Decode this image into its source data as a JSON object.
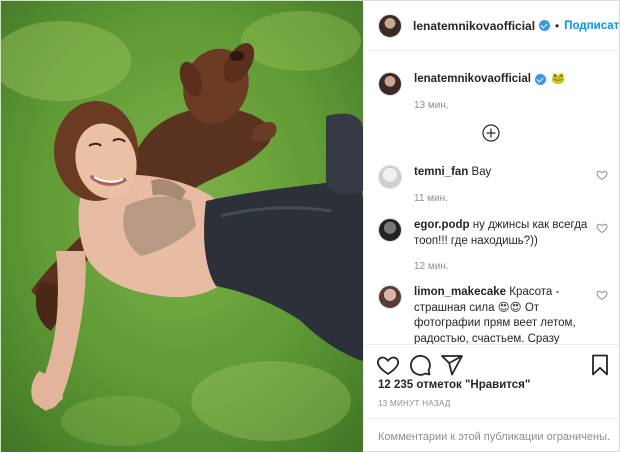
{
  "header": {
    "username": "lenatemnikovaofficial",
    "separator": "•",
    "follow_label": "Подписаться"
  },
  "caption": {
    "username": "lenatemnikovaofficial",
    "text": "🐸",
    "time": "13 мин."
  },
  "comments": [
    {
      "username": "temni_fan",
      "text": "Вау",
      "time": "11 мин."
    },
    {
      "username": "egor.podp",
      "text": "ну джинсы как всегда тооп!!! где находишь?))",
      "time": "12 мин."
    },
    {
      "username": "limon_makecake",
      "text": "Красота - страшная сила 😍😍 От фотографии прям веет летом, радостью, счастьем. Сразу"
    }
  ],
  "likes_text": "12 235 отметок \"Нравится\"",
  "posted_time": "13 минут назад",
  "footer_text": "Комментарии к этой публикации ограничены.",
  "icons": [
    "verified-badge-icon",
    "add-comments-icon",
    "heart-icon",
    "comment-icon",
    "share-icon",
    "bookmark-icon"
  ],
  "colors": {
    "link_blue": "#0095f6",
    "verified_blue": "#3897f0",
    "muted": "#8e8e8e",
    "border": "#efefef"
  }
}
